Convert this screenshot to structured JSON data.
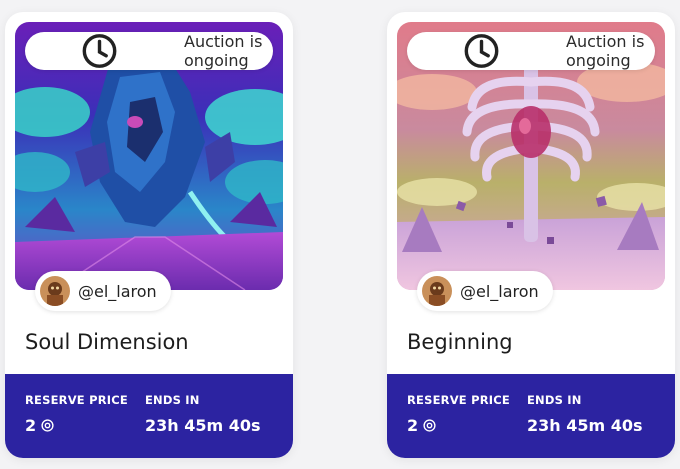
{
  "cards": [
    {
      "status_label": "Auction is ongoing",
      "status_icon": "clock-icon",
      "artwork": "alien-creature-in-purple-neon-landscape",
      "creator_handle": "@el_laron",
      "title": "Soul Dimension",
      "reserve_caption": "RESERVE PRICE",
      "reserve_value": "2",
      "currency_icon": "coin-icon",
      "ends_caption": "ENDS IN",
      "ends_value": "23h 45m 40s"
    },
    {
      "status_label": "Auction is ongoing",
      "status_icon": "clock-icon",
      "artwork": "giant-ribcage-in-pink-desert",
      "creator_handle": "@el_laron",
      "title": "Beginning",
      "reserve_caption": "RESERVE PRICE",
      "reserve_value": "2",
      "currency_icon": "coin-icon",
      "ends_caption": "ENDS IN",
      "ends_value": "23h 45m 40s"
    }
  ],
  "colors": {
    "footer_bg": "#2c23a1",
    "card_bg": "#ffffff",
    "page_bg": "#f3f3f5"
  }
}
